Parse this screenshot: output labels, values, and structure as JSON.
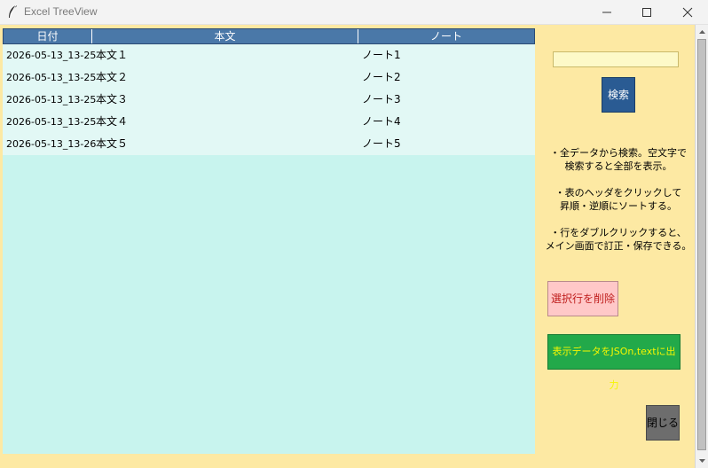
{
  "window": {
    "title": "Excel TreeView",
    "icons": {
      "app": "feather-icon",
      "minimize": "minimize-icon",
      "maximize": "maximize-icon",
      "close": "close-icon"
    }
  },
  "tree": {
    "columns": [
      "日付",
      "本文",
      "ノート"
    ],
    "rows": [
      {
        "date": "2026-05-13_13-25",
        "body": "本文１",
        "note": "ノート1"
      },
      {
        "date": "2026-05-13_13-25",
        "body": "本文２",
        "note": "ノート2"
      },
      {
        "date": "2026-05-13_13-25",
        "body": "本文３",
        "note": "ノート3"
      },
      {
        "date": "2026-05-13_13-25",
        "body": "本文４",
        "note": "ノート4"
      },
      {
        "date": "2026-05-13_13-26",
        "body": "本文５",
        "note": "ノート5"
      }
    ]
  },
  "panel": {
    "search_value": "",
    "search_button": "検索",
    "help": [
      [
        "・全データから検索。空文字で",
        "検索すると全部を表示。"
      ],
      [
        "・表のヘッダをクリックして",
        "昇順・逆順にソートする。"
      ],
      [
        "・行をダブルクリックすると、",
        "メイン画面で訂正・保存できる。"
      ]
    ],
    "delete_button": "選択行を削除",
    "export_button": "表示データをJSOn,textに出力",
    "close_button": "閉じる"
  },
  "colors": {
    "background": "#fde9a3",
    "header": "#4a78a8",
    "row": "#e2f8f5",
    "tree_empty": "#c8f4ee",
    "search_button": "#2a5b93",
    "delete_button": "#ffc8c8",
    "export_button": "#22a94a",
    "close_button": "#6d6d6d"
  }
}
